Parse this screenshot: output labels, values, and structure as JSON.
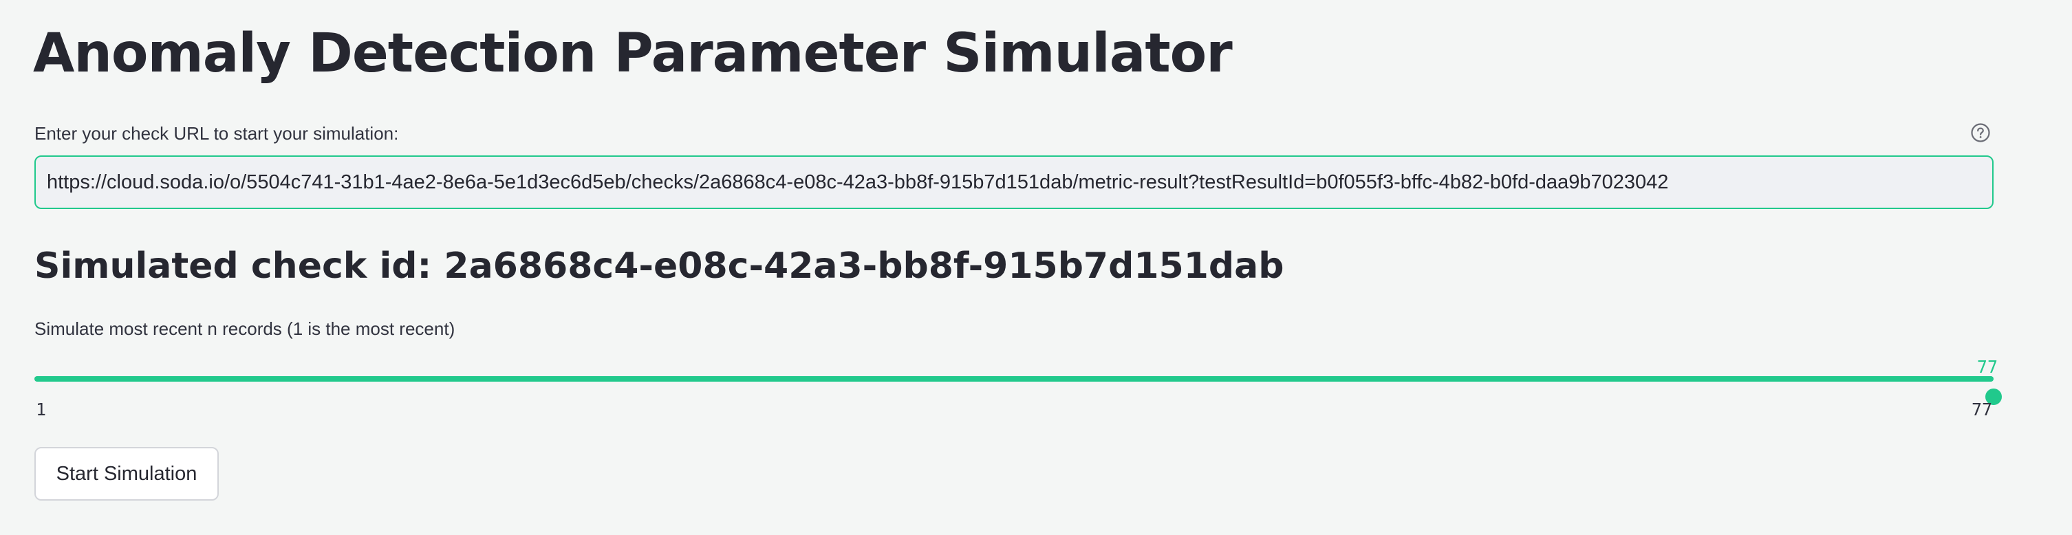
{
  "page": {
    "title": "Anomaly Detection Parameter Simulator"
  },
  "url_field": {
    "label": "Enter your check URL to start your simulation:",
    "value": "https://cloud.soda.io/o/5504c741-31b1-4ae2-8e6a-5e1d3ec6d5eb/checks/2a6868c4-e08c-42a3-bb8f-915b7d151dab/metric-result?testResultId=b0f055f3-bffc-4b82-b0fd-daa9b7023042",
    "help_icon": "question-circle-icon"
  },
  "check": {
    "heading": "Simulated check id: 2a6868c4-e08c-42a3-bb8f-915b7d151dab"
  },
  "slider": {
    "label": "Simulate most recent n records (1 is the most recent)",
    "value": "77",
    "min_label": "1",
    "max_label": "77",
    "min": 1,
    "max": 77,
    "current": 77
  },
  "actions": {
    "start_label": "Start Simulation"
  },
  "colors": {
    "accent": "#21c98c",
    "background": "#f4f6f5",
    "text": "#262730",
    "input_background": "#eff1f4"
  }
}
